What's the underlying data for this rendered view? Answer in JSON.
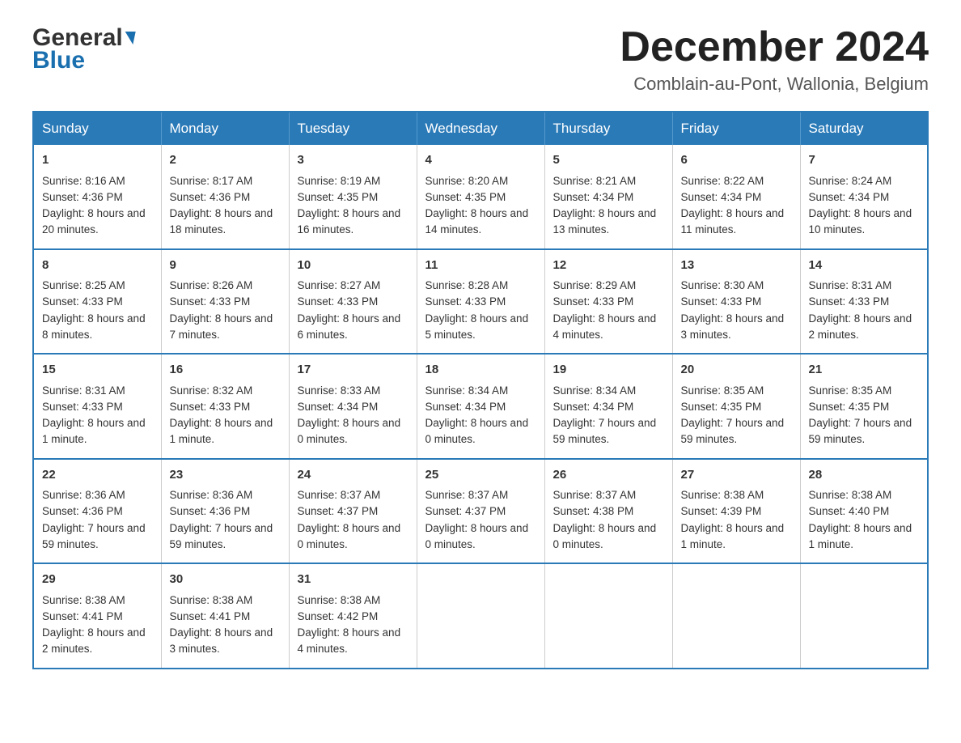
{
  "header": {
    "logo_general": "General",
    "logo_blue": "Blue",
    "month_title": "December 2024",
    "location": "Comblain-au-Pont, Wallonia, Belgium"
  },
  "weekdays": [
    "Sunday",
    "Monday",
    "Tuesday",
    "Wednesday",
    "Thursday",
    "Friday",
    "Saturday"
  ],
  "weeks": [
    [
      {
        "day": "1",
        "sunrise": "8:16 AM",
        "sunset": "4:36 PM",
        "daylight": "8 hours and 20 minutes."
      },
      {
        "day": "2",
        "sunrise": "8:17 AM",
        "sunset": "4:36 PM",
        "daylight": "8 hours and 18 minutes."
      },
      {
        "day": "3",
        "sunrise": "8:19 AM",
        "sunset": "4:35 PM",
        "daylight": "8 hours and 16 minutes."
      },
      {
        "day": "4",
        "sunrise": "8:20 AM",
        "sunset": "4:35 PM",
        "daylight": "8 hours and 14 minutes."
      },
      {
        "day": "5",
        "sunrise": "8:21 AM",
        "sunset": "4:34 PM",
        "daylight": "8 hours and 13 minutes."
      },
      {
        "day": "6",
        "sunrise": "8:22 AM",
        "sunset": "4:34 PM",
        "daylight": "8 hours and 11 minutes."
      },
      {
        "day": "7",
        "sunrise": "8:24 AM",
        "sunset": "4:34 PM",
        "daylight": "8 hours and 10 minutes."
      }
    ],
    [
      {
        "day": "8",
        "sunrise": "8:25 AM",
        "sunset": "4:33 PM",
        "daylight": "8 hours and 8 minutes."
      },
      {
        "day": "9",
        "sunrise": "8:26 AM",
        "sunset": "4:33 PM",
        "daylight": "8 hours and 7 minutes."
      },
      {
        "day": "10",
        "sunrise": "8:27 AM",
        "sunset": "4:33 PM",
        "daylight": "8 hours and 6 minutes."
      },
      {
        "day": "11",
        "sunrise": "8:28 AM",
        "sunset": "4:33 PM",
        "daylight": "8 hours and 5 minutes."
      },
      {
        "day": "12",
        "sunrise": "8:29 AM",
        "sunset": "4:33 PM",
        "daylight": "8 hours and 4 minutes."
      },
      {
        "day": "13",
        "sunrise": "8:30 AM",
        "sunset": "4:33 PM",
        "daylight": "8 hours and 3 minutes."
      },
      {
        "day": "14",
        "sunrise": "8:31 AM",
        "sunset": "4:33 PM",
        "daylight": "8 hours and 2 minutes."
      }
    ],
    [
      {
        "day": "15",
        "sunrise": "8:31 AM",
        "sunset": "4:33 PM",
        "daylight": "8 hours and 1 minute."
      },
      {
        "day": "16",
        "sunrise": "8:32 AM",
        "sunset": "4:33 PM",
        "daylight": "8 hours and 1 minute."
      },
      {
        "day": "17",
        "sunrise": "8:33 AM",
        "sunset": "4:34 PM",
        "daylight": "8 hours and 0 minutes."
      },
      {
        "day": "18",
        "sunrise": "8:34 AM",
        "sunset": "4:34 PM",
        "daylight": "8 hours and 0 minutes."
      },
      {
        "day": "19",
        "sunrise": "8:34 AM",
        "sunset": "4:34 PM",
        "daylight": "7 hours and 59 minutes."
      },
      {
        "day": "20",
        "sunrise": "8:35 AM",
        "sunset": "4:35 PM",
        "daylight": "7 hours and 59 minutes."
      },
      {
        "day": "21",
        "sunrise": "8:35 AM",
        "sunset": "4:35 PM",
        "daylight": "7 hours and 59 minutes."
      }
    ],
    [
      {
        "day": "22",
        "sunrise": "8:36 AM",
        "sunset": "4:36 PM",
        "daylight": "7 hours and 59 minutes."
      },
      {
        "day": "23",
        "sunrise": "8:36 AM",
        "sunset": "4:36 PM",
        "daylight": "7 hours and 59 minutes."
      },
      {
        "day": "24",
        "sunrise": "8:37 AM",
        "sunset": "4:37 PM",
        "daylight": "8 hours and 0 minutes."
      },
      {
        "day": "25",
        "sunrise": "8:37 AM",
        "sunset": "4:37 PM",
        "daylight": "8 hours and 0 minutes."
      },
      {
        "day": "26",
        "sunrise": "8:37 AM",
        "sunset": "4:38 PM",
        "daylight": "8 hours and 0 minutes."
      },
      {
        "day": "27",
        "sunrise": "8:38 AM",
        "sunset": "4:39 PM",
        "daylight": "8 hours and 1 minute."
      },
      {
        "day": "28",
        "sunrise": "8:38 AM",
        "sunset": "4:40 PM",
        "daylight": "8 hours and 1 minute."
      }
    ],
    [
      {
        "day": "29",
        "sunrise": "8:38 AM",
        "sunset": "4:41 PM",
        "daylight": "8 hours and 2 minutes."
      },
      {
        "day": "30",
        "sunrise": "8:38 AM",
        "sunset": "4:41 PM",
        "daylight": "8 hours and 3 minutes."
      },
      {
        "day": "31",
        "sunrise": "8:38 AM",
        "sunset": "4:42 PM",
        "daylight": "8 hours and 4 minutes."
      },
      null,
      null,
      null,
      null
    ]
  ],
  "labels": {
    "sunrise_prefix": "Sunrise: ",
    "sunset_prefix": "Sunset: ",
    "daylight_prefix": "Daylight: "
  }
}
